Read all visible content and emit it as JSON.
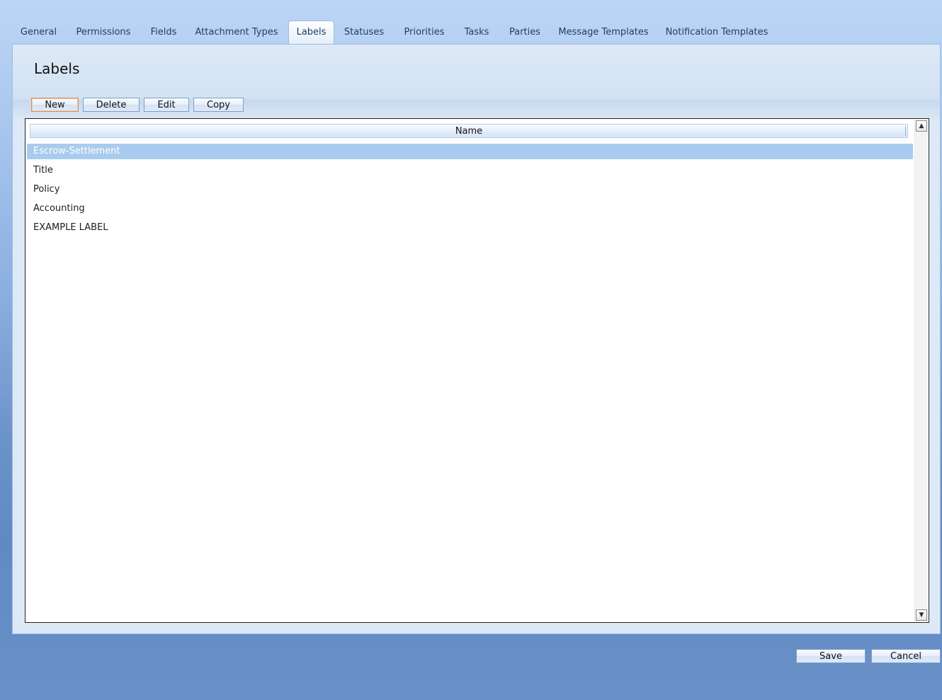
{
  "tabs": [
    {
      "label": "General"
    },
    {
      "label": "Permissions"
    },
    {
      "label": "Fields"
    },
    {
      "label": "Attachment Types"
    },
    {
      "label": "Labels",
      "active": true
    },
    {
      "label": "Statuses"
    },
    {
      "label": "Priorities"
    },
    {
      "label": "Tasks"
    },
    {
      "label": "Parties"
    },
    {
      "label": "Message Templates"
    },
    {
      "label": "Notification Templates"
    }
  ],
  "panel": {
    "title": "Labels",
    "toolbar": {
      "new_label": "New",
      "delete_label": "Delete",
      "edit_label": "Edit",
      "copy_label": "Copy"
    },
    "grid": {
      "column_header": "Name",
      "rows": [
        {
          "name": "Escrow-Settlement",
          "selected": true
        },
        {
          "name": "Title"
        },
        {
          "name": "Policy"
        },
        {
          "name": "Accounting"
        },
        {
          "name": "EXAMPLE LABEL"
        }
      ]
    }
  },
  "footer": {
    "save_label": "Save",
    "cancel_label": "Cancel"
  },
  "icons": {
    "scroll_up": "scroll-up-arrow-icon",
    "scroll_down": "scroll-down-arrow-icon"
  },
  "colors": {
    "selection": "#a9cbef",
    "accent": "#1f3f66"
  }
}
